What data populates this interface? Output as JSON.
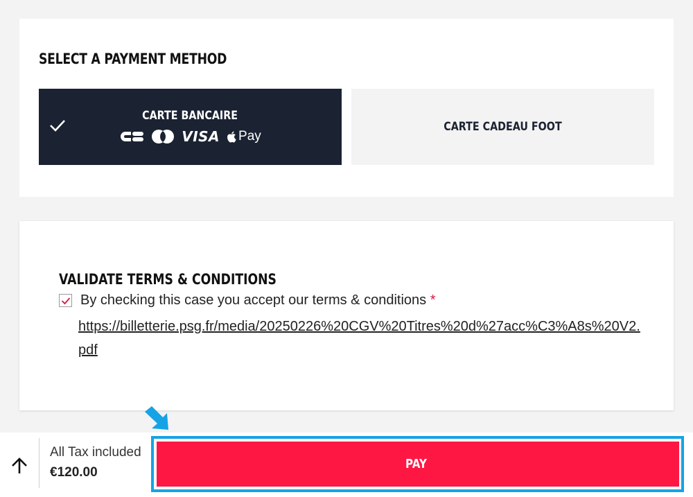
{
  "payment": {
    "title": "SELECT A PAYMENT METHOD",
    "methods": [
      {
        "label": "CARTE BANCAIRE",
        "selected": true,
        "brands": [
          "CB",
          "Mastercard",
          "VISA",
          "Apple Pay"
        ]
      },
      {
        "label": "CARTE CADEAU FOOT",
        "selected": false
      }
    ],
    "visa_text": "VISA",
    "apple_pay_text": "Pay"
  },
  "terms": {
    "title": "VALIDATE TERMS & CONDITIONS",
    "checkbox_checked": true,
    "text": "By checking this case you accept our terms & conditions",
    "required_mark": "*",
    "link": "https://billetterie.psg.fr/media/20250226%20CGV%20Titres%20d%27acc%C3%A8s%20V2.pdf"
  },
  "footer": {
    "tax_label": "All Tax included",
    "price": "€120.00",
    "pay_label": "PAY",
    "up_icon": "arrow-up-icon"
  },
  "colors": {
    "selected_bg": "#1b2232",
    "pay_button": "#ff1744",
    "highlight": "#16a3e5",
    "required": "#e0163e"
  }
}
